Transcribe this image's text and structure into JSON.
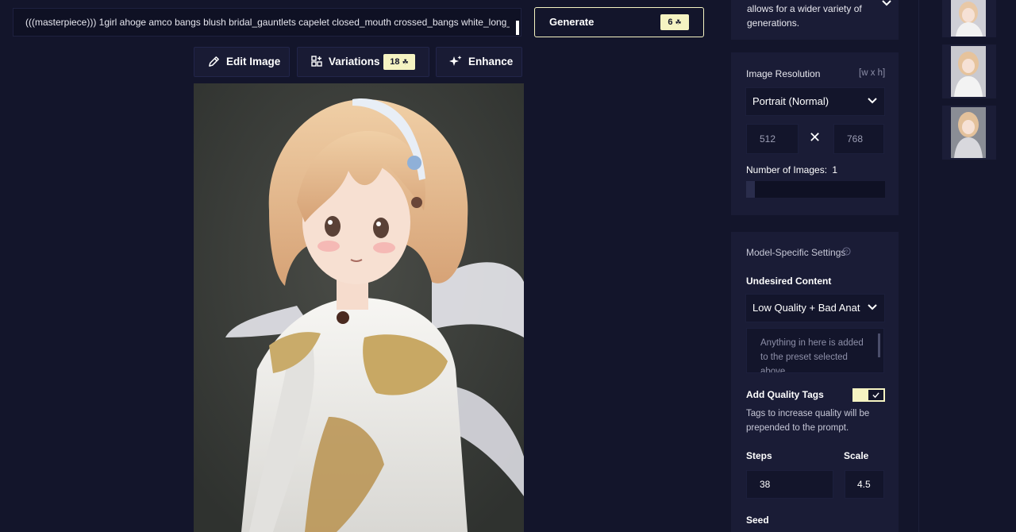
{
  "prompt": {
    "text": "(((masterpiece))) 1girl ahoge amco bangs blush bridal_gauntlets capelet closed_mouth crossed_bangs white_long_dres"
  },
  "generate": {
    "label": "Generate",
    "cost": "6"
  },
  "toolbar": {
    "edit_label": "Edit Image",
    "variations_label": "Variations",
    "variations_cost": "18",
    "enhance_label": "Enhance"
  },
  "sidebar": {
    "top_note": "allows for a wider variety of generations.",
    "resolution": {
      "title": "Image Resolution",
      "hint": "[w x h]",
      "preset": "Portrait (Normal)",
      "width": "512",
      "height": "768",
      "times": "✕"
    },
    "num_images": {
      "label": "Number of Images:",
      "value": "1"
    },
    "model": {
      "title": "Model-Specific Settings",
      "undesired_label": "Undesired Content",
      "undesired_preset": "Low Quality + Bad Anatomy",
      "undesired_placeholder": "Anything in here is added to the preset selected above.",
      "quality_tags_label": "Add Quality Tags",
      "quality_tags_desc": "Tags to increase quality will be prepended to the prompt.",
      "steps_label": "Steps",
      "steps_value": "38",
      "scale_label": "Scale",
      "scale_value": "4.5",
      "seed_label": "Seed"
    }
  },
  "colors": {
    "background": "#13152b",
    "panel": "#1a1c36",
    "accent": "#f5f3c2"
  }
}
